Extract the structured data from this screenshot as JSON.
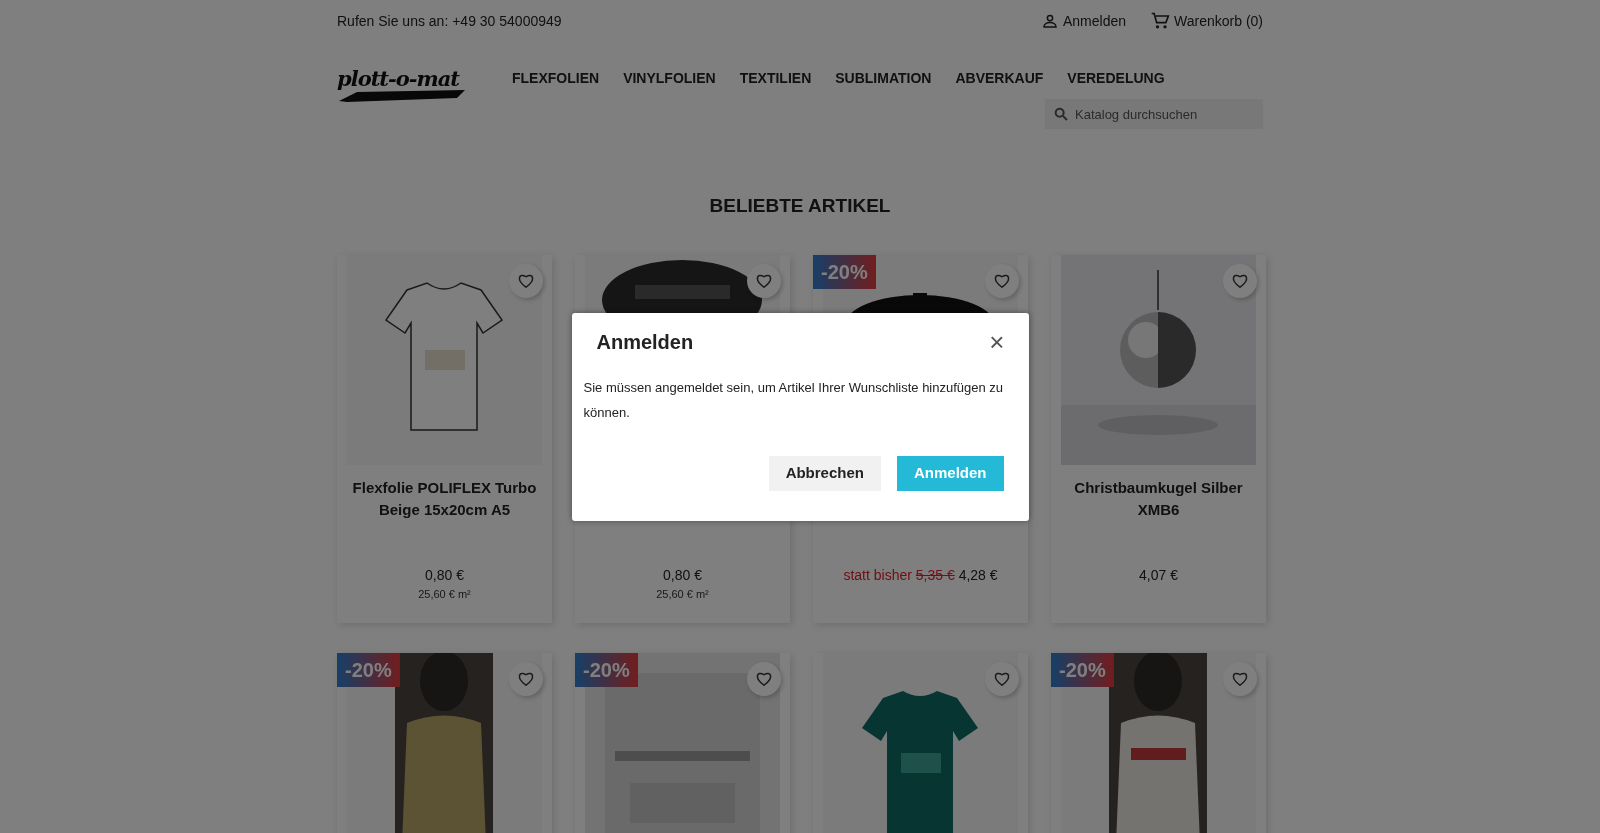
{
  "header": {
    "phone": "Rufen Sie uns an: +49 30 54000949",
    "sign_in": "Anmelden",
    "cart": "Warenkorb (0)",
    "logo": "plott-o-mat",
    "menu": [
      "FLEXFOLIEN",
      "VINYLFOLIEN",
      "TEXTILIEN",
      "SUBLIMATION",
      "ABVERKAUF",
      "VEREDELUNG"
    ],
    "search": {
      "placeholder": "Katalog durchsuchen"
    }
  },
  "section_title": "BELIEBTE ARTIKEL",
  "products": [
    {
      "image": {
        "kind": "picture"
      },
      "title": "Flexfolie POLIFLEX Turbo Beige 15x20cm A5",
      "price": "0,80 €",
      "unit_price": "25,60 € m²"
    },
    {
      "image": {
        "kind": "picture"
      },
      "price": "0,80 €",
      "unit_price": "25,60 € m²"
    },
    {
      "image": {
        "kind": "picture"
      },
      "discount": "-20%",
      "price_prefix": "statt bisher",
      "old_price": "5,35 €",
      "price": "4,28 €"
    },
    {
      "image": {
        "kind": "picture"
      },
      "title": "Christbaumkugel Silber XMB6",
      "price": "4,07 €"
    },
    {
      "image": {
        "kind": "picture"
      },
      "discount": "-20%"
    },
    {
      "image": {
        "kind": "picture"
      },
      "discount": "-20%"
    },
    {
      "image": {
        "kind": "picture"
      }
    },
    {
      "image": {
        "kind": "picture"
      },
      "discount": "-20%"
    }
  ],
  "modal": {
    "title": "Anmelden",
    "close": "×",
    "body": "Sie müssen angemeldet sein, um Artikel Ihrer Wunschliste hinzufügen zu können.",
    "buttons": [
      {
        "label": "Abbrechen",
        "kind": "secondary"
      },
      {
        "label": "Anmelden",
        "kind": "primary"
      }
    ]
  }
}
